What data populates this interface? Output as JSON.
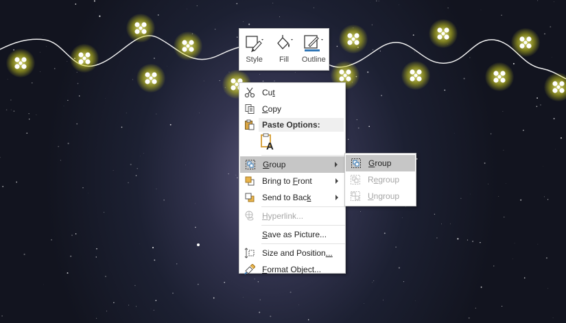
{
  "mini_toolbar": {
    "style_label": "Style",
    "fill_label": "Fill",
    "outline_label": "Outline"
  },
  "context_menu": {
    "cut": {
      "pre": "Cu",
      "acc": "t",
      "post": ""
    },
    "copy": {
      "pre": "",
      "acc": "C",
      "post": "opy"
    },
    "paste_options": "Paste Options:",
    "group": {
      "pre": "",
      "acc": "G",
      "post": "roup"
    },
    "bring_to_front": {
      "pre": "Bring to ",
      "acc": "F",
      "post": "ront"
    },
    "send_to_back": {
      "pre": "Send to Bac",
      "acc": "k",
      "post": ""
    },
    "hyperlink": {
      "pre": "",
      "acc": "H",
      "post": "yperlink..."
    },
    "save_as_picture": {
      "pre": "",
      "acc": "S",
      "post": "ave as Picture..."
    },
    "size_and_position": {
      "pre": "Size and Position",
      "acc": "...",
      "post": ""
    },
    "format_object": {
      "pre": "",
      "acc": "F",
      "post": "ormat Object..."
    }
  },
  "group_submenu": {
    "group": {
      "pre": "",
      "acc": "G",
      "post": "roup"
    },
    "regroup": {
      "pre": "R",
      "acc": "e",
      "post": "group"
    },
    "ungroup": {
      "pre": "",
      "acc": "U",
      "post": "ngroup"
    }
  },
  "colors": {
    "highlight": "#c6c6c6",
    "disabled_text": "#a6a6a6",
    "bulb_glow": "#f5f57a"
  }
}
